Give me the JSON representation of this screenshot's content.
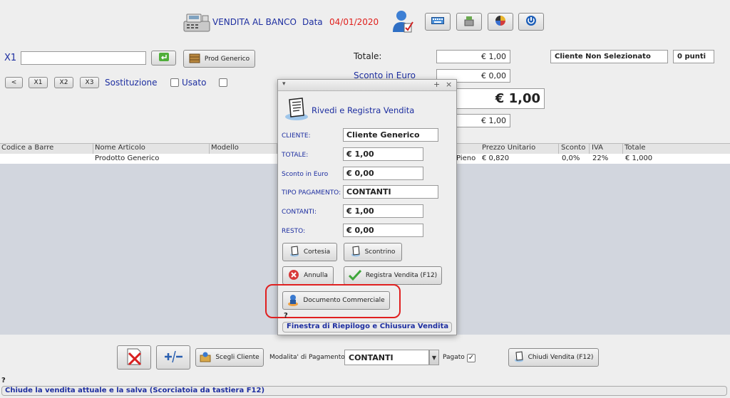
{
  "header": {
    "title": "VENDITA AL BANCO",
    "date_label": "Data",
    "date_value": "04/01/2020",
    "colors": {
      "date": "#e0201c",
      "title": "#1d2ea0"
    }
  },
  "toolbar_icons": [
    "keyboard-icon",
    "cash-register-icon",
    "color-wheel-icon",
    "power-icon"
  ],
  "search": {
    "x1_label": "X1",
    "value": "",
    "prod_generico": "Prod Generico"
  },
  "qty_buttons": [
    "<",
    "X1",
    "X2",
    "X3"
  ],
  "options": {
    "sostituzione": "Sostituzione",
    "usato": "Usato"
  },
  "totals": {
    "totale_label": "Totale:",
    "totale_value": "€ 1,00",
    "sconto_label": "Sconto in Euro",
    "sconto_value": "€ 0,00",
    "big_total": "€ 1,00",
    "fourth_value": "€ 1,00",
    "cliente": "Cliente Non Selezionato",
    "punti": "0 punti"
  },
  "table": {
    "headers": [
      "Codice a Barre",
      "Nome Articolo",
      "Modello",
      "Prezzo Unitario",
      "Sconto",
      "IVA",
      "Totale"
    ],
    "rows": [
      {
        "nome": "Prodotto Generico",
        "partial": "Pieno",
        "prezzo": "€ 0,820",
        "sconto": "0,0%",
        "iva": "22%",
        "totale": "€ 1,000"
      }
    ]
  },
  "dialog": {
    "title": "Rivedi e Registra Vendita",
    "cliente_label": "CLIENTE:",
    "cliente_value": "Cliente Generico",
    "totale_label": "TOTALE:",
    "totale_value": "€ 1,00",
    "sconto_label": "Sconto in Euro",
    "sconto_value": "€ 0,00",
    "tipo_label": "TIPO PAGAMENTO:",
    "tipo_value": "CONTANTI",
    "contanti_label": "CONTANTI:",
    "contanti_value": "€ 1,00",
    "resto_label": "RESTO:",
    "resto_value": "€ 0,00",
    "btn_cortesia": "Cortesia",
    "btn_scontrino": "Scontrino",
    "btn_annulla": "Annulla",
    "btn_registra": "Registra Vendita (F12)",
    "btn_documento": "Documento Commerciale",
    "tooltip_q": "?",
    "footer": "Finestra di Riepilogo e Chiusura Vendita",
    "highlight_color": "#e02020"
  },
  "bottom": {
    "scegli_cliente": "Scegli Cliente",
    "modalita_label": "Modalita' di Pagamento",
    "modalita_value": "CONTANTI",
    "pagato_label": "Pagato",
    "chiudi": "Chiudi Vendita (F12)"
  },
  "status": {
    "q": "?",
    "text": "Chiude la vendita attuale e la salva (Scorciatoia da tastiera F12)"
  }
}
